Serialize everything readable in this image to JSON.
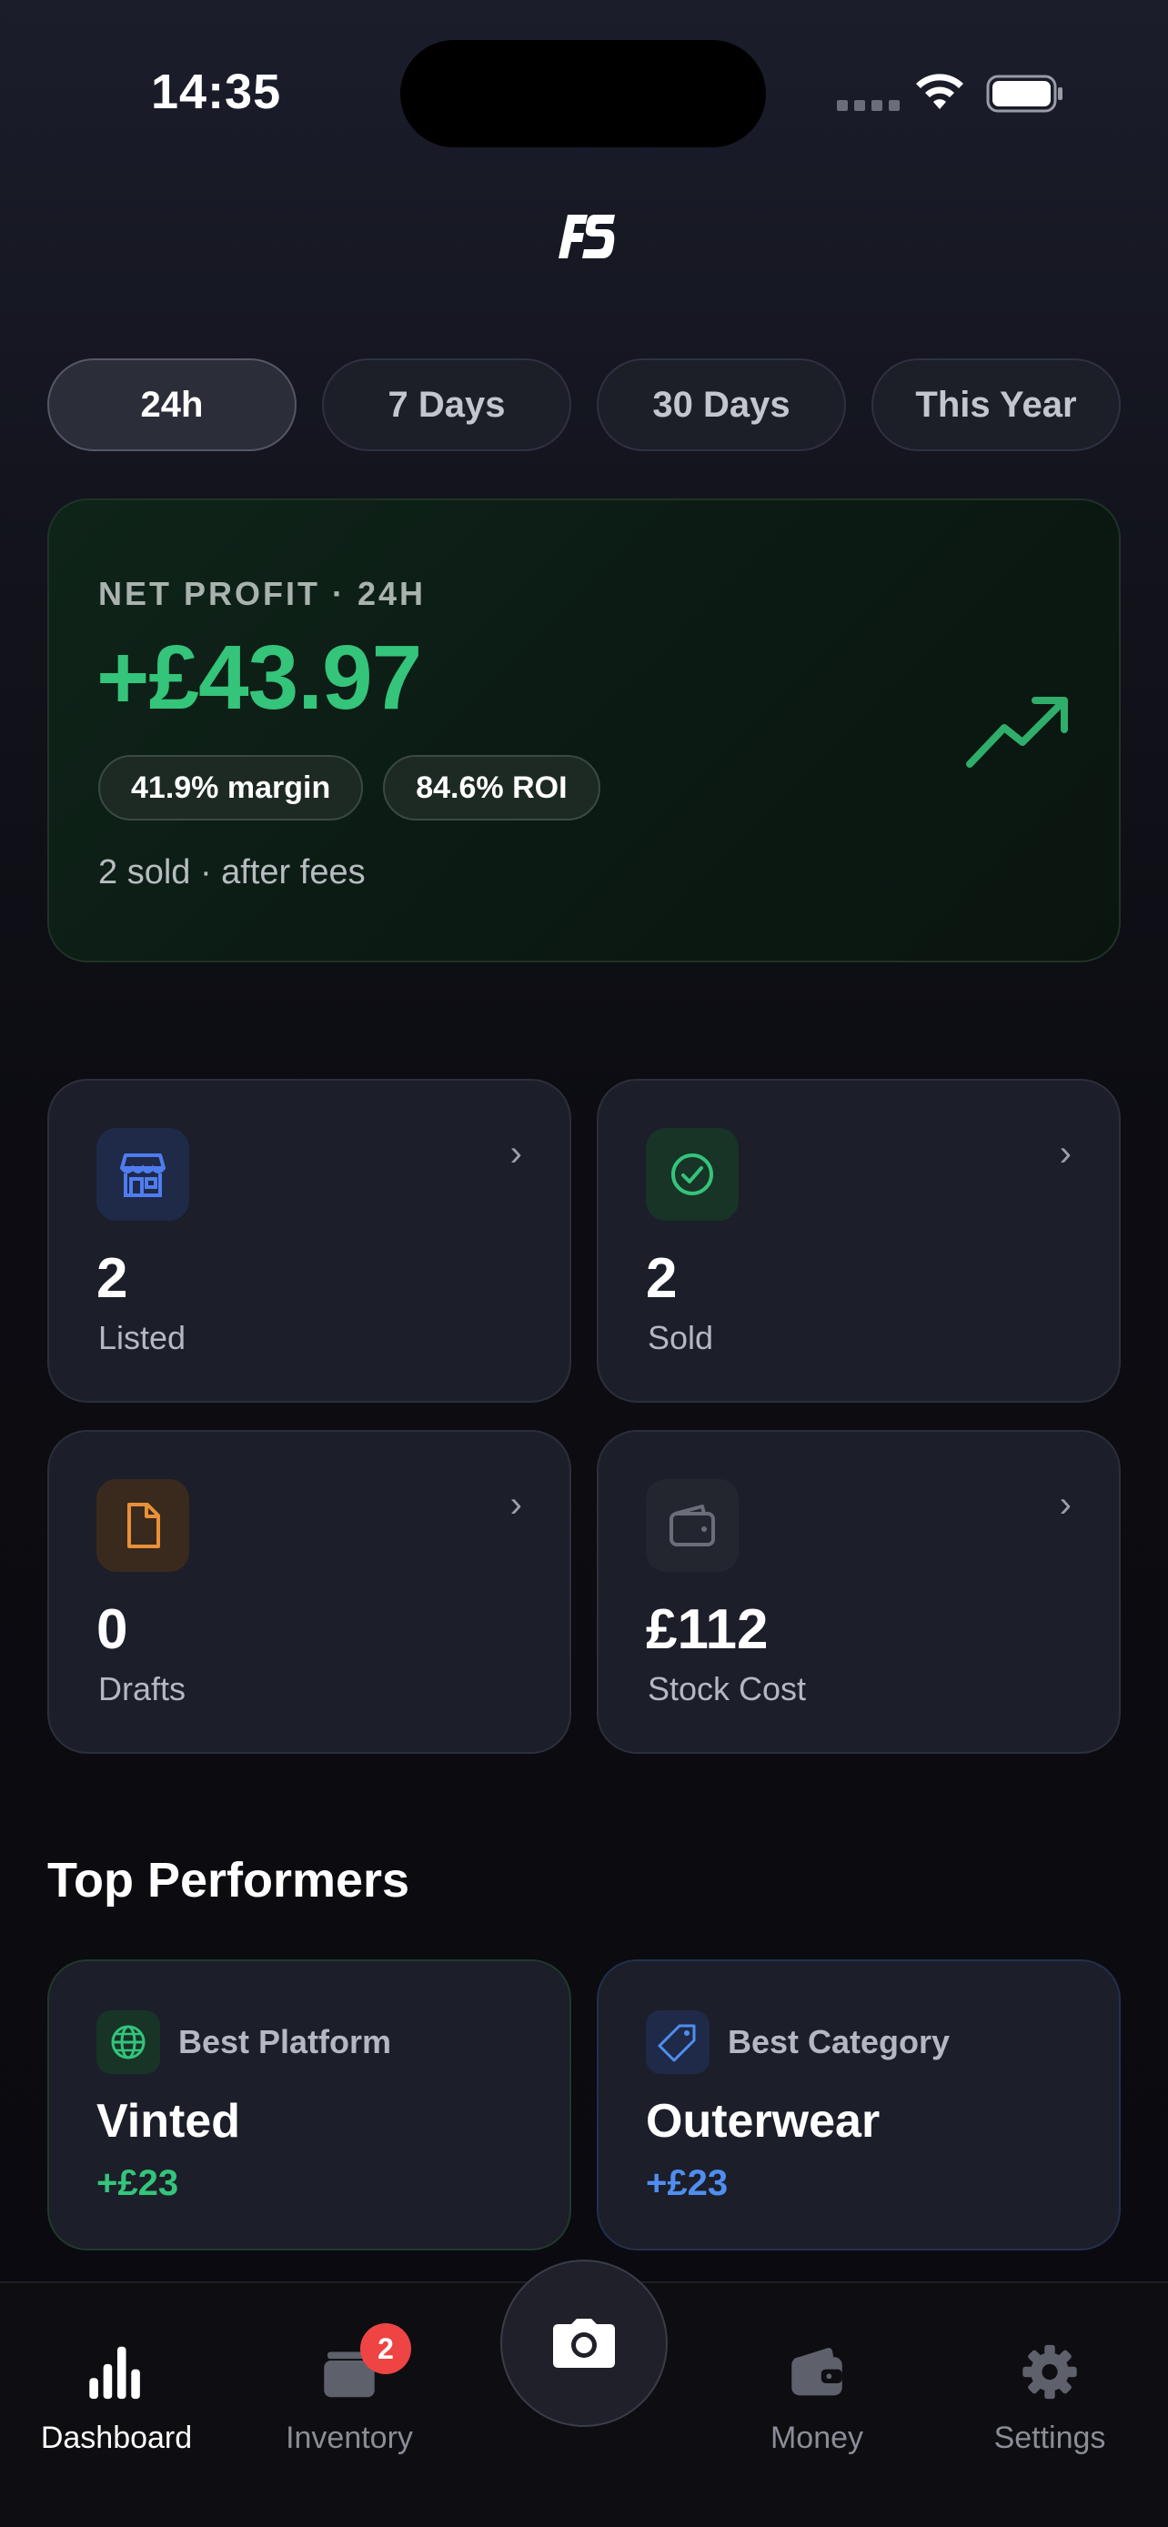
{
  "status_bar": {
    "time": "14:35"
  },
  "app": {
    "logo_text": "FS"
  },
  "period_tabs": [
    {
      "label": "24h",
      "active": true
    },
    {
      "label": "7 Days",
      "active": false
    },
    {
      "label": "30 Days",
      "active": false
    },
    {
      "label": "This Year",
      "active": false
    }
  ],
  "profit": {
    "label": "NET PROFIT · 24H",
    "value": "+£43.97",
    "margin": "41.9% margin",
    "roi": "84.6% ROI",
    "subtitle": "2 sold · after fees",
    "accent_color": "#34c47a"
  },
  "stats": [
    {
      "value": "2",
      "label": "Listed",
      "icon": "storefront-icon",
      "color": "#4f7cf0"
    },
    {
      "value": "2",
      "label": "Sold",
      "icon": "check-circle-icon",
      "color": "#34c47a"
    },
    {
      "value": "0",
      "label": "Drafts",
      "icon": "document-icon",
      "color": "#e8903a"
    },
    {
      "value": "£112",
      "label": "Stock Cost",
      "icon": "wallet-icon",
      "color": "#6b6e79"
    }
  ],
  "top_performers": {
    "title": "Top Performers",
    "platform": {
      "label": "Best Platform",
      "name": "Vinted",
      "value": "+£23",
      "color": "#34c47a"
    },
    "category": {
      "label": "Best Category",
      "name": "Outerwear",
      "value": "+£23",
      "color": "#4f8ef0"
    }
  },
  "nav": {
    "dashboard": "Dashboard",
    "inventory": "Inventory",
    "inventory_badge": "2",
    "money": "Money",
    "settings": "Settings"
  }
}
